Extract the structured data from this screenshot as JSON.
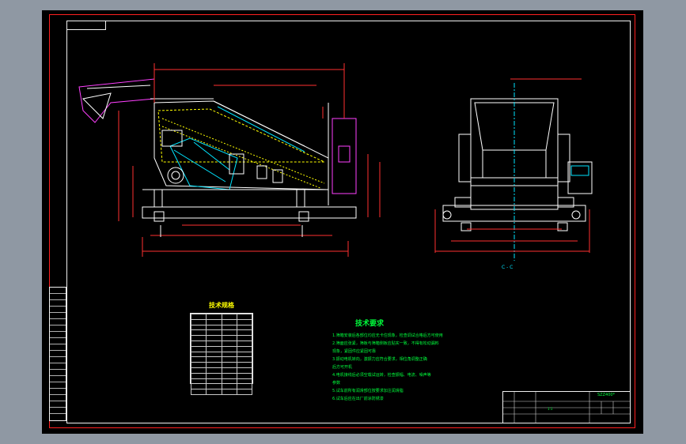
{
  "drawing": {
    "view_label": "C - C",
    "tech_requirements": {
      "title": "技术要求",
      "notes": [
        "1.筛箱安装后各部位均应无卡住现象，检查调试合格后方可使用",
        "2.筛面应张紧，筛板与筛箱侧板应贴实一致，不得有松动漏料",
        "  现象，紧固件应紧固可靠",
        "3.振动电机转向，激振力应符合要求，相位角调整正确",
        "  后方可开机",
        "4.电机接线后必须空载试运转，检查振幅、电流、噪声等",
        "  参数",
        "5.试车前所有润滑部位按要求加注润滑脂",
        "6.试车后应在出厂前涂防锈漆"
      ]
    },
    "spec_table": {
      "title": "技术规格"
    },
    "title_block": {
      "drawing_code": "SZZ400*",
      "scale": "1:1"
    }
  }
}
